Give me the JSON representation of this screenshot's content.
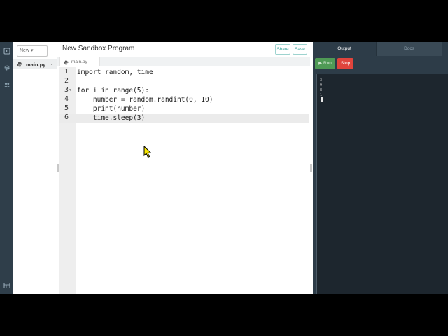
{
  "sidebar": {
    "new_label": "New ▾",
    "file": "main.py"
  },
  "editor": {
    "title": "New Sandbox Program",
    "share_label": "Share",
    "save_label": "Save",
    "tab_label": "main.py",
    "lines": [
      {
        "num": "1",
        "text": "import random, time"
      },
      {
        "num": "2",
        "text": ""
      },
      {
        "num": "3",
        "text": "for i in range(5):"
      },
      {
        "num": "4",
        "text": "    number = random.randint(0, 10)"
      },
      {
        "num": "5",
        "text": "    print(number)"
      },
      {
        "num": "6",
        "text": "    time.sleep(3)"
      }
    ]
  },
  "output": {
    "tab_output": "Output",
    "tab_docs": "Docs",
    "run_label": "Run",
    "stop_label": "Stop",
    "console_lines": [
      "3",
      "9",
      "8",
      "1"
    ]
  },
  "colors": {
    "run": "#4f9a55",
    "stop": "#e0443c",
    "accent": "#3aa39b"
  }
}
